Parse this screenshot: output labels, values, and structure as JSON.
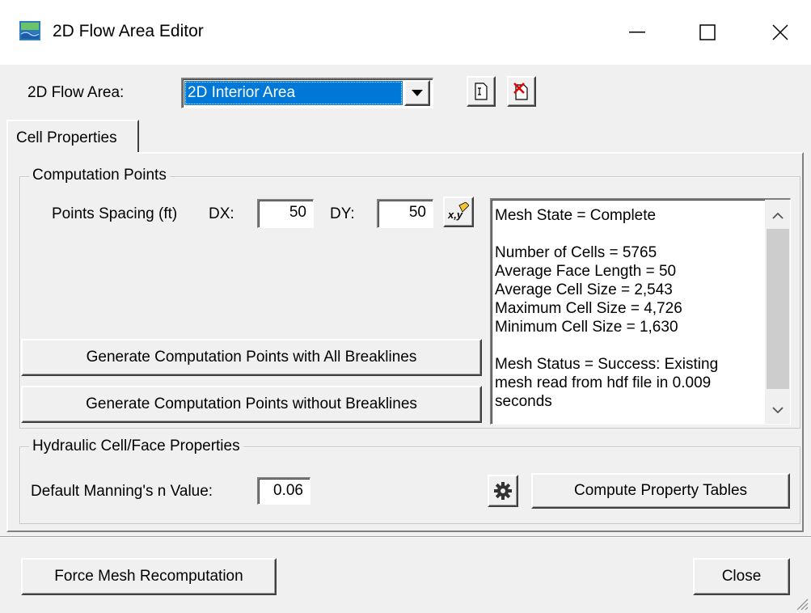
{
  "window": {
    "title": "2D Flow Area Editor",
    "controls": {
      "minimize": "—",
      "maximize": "☐",
      "close": "✕"
    }
  },
  "flow_area": {
    "label": "2D Flow Area:",
    "selected": "2D Interior Area"
  },
  "tabs": [
    {
      "label": "Cell Properties",
      "active": true
    }
  ],
  "computation_points": {
    "group_label": "Computation Points",
    "spacing_label": "Points Spacing (ft)",
    "dx_label": "DX:",
    "dx_value": "50",
    "dy_label": "DY:",
    "dy_value": "50",
    "generate_with_breaklines": "Generate Computation Points with All Breaklines",
    "generate_without_breaklines": "Generate Computation Points without Breaklines"
  },
  "mesh_info": {
    "lines": [
      "Mesh State = Complete",
      "",
      "Number of Cells = 5765",
      "Average Face Length = 50",
      "Average Cell Size = 2,543",
      "Maximum Cell Size = 4,726",
      "Minimum Cell Size = 1,630",
      "",
      "Mesh Status = Success: Existing",
      "mesh read from hdf file in 0.009",
      "seconds"
    ]
  },
  "hydraulic": {
    "group_label": "Hydraulic Cell/Face Properties",
    "manning_label": "Default Manning's n Value:",
    "manning_value": "0.06",
    "compute_button": "Compute Property Tables"
  },
  "footer": {
    "force_button": "Force Mesh Recomputation",
    "close_button": "Close"
  },
  "colors": {
    "selection": "#0078d7",
    "dialog_bg": "#f0f0f0",
    "title_bg": "#ffffff"
  }
}
